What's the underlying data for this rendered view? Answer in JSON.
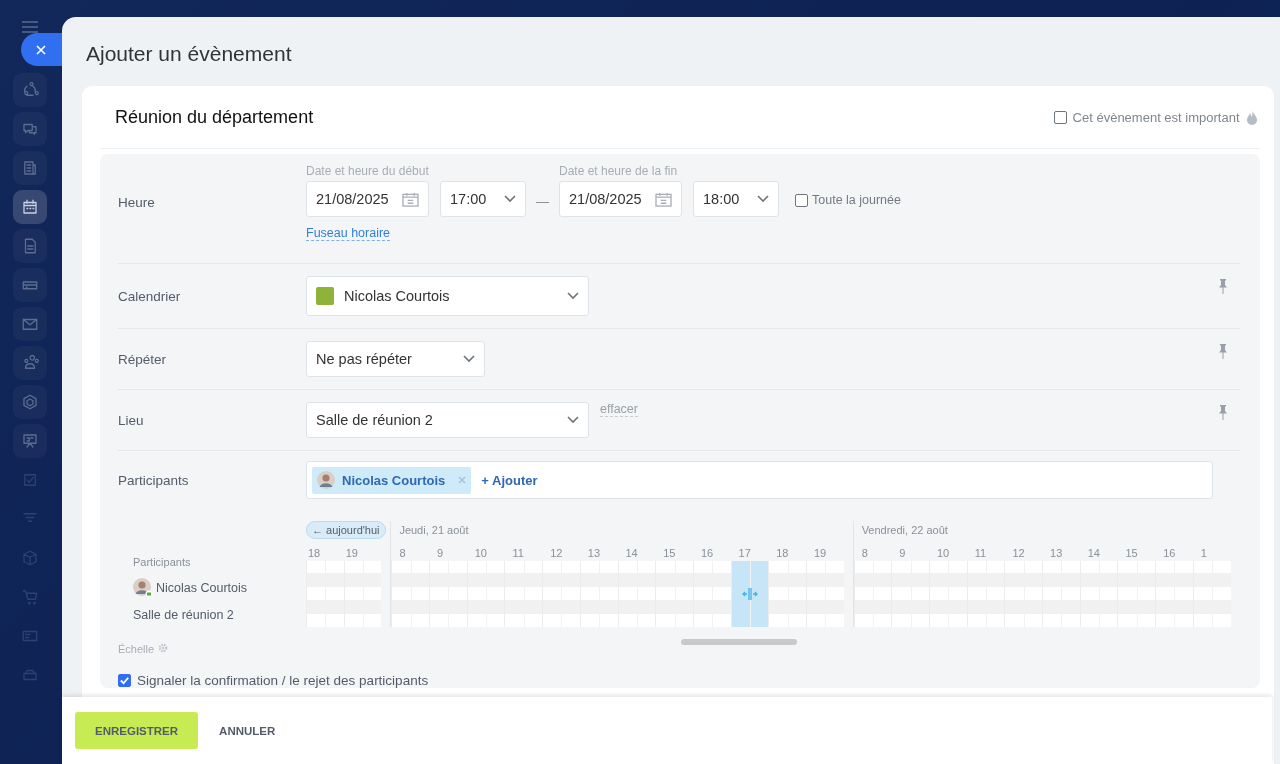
{
  "window": {
    "title": "Ajouter un évènement"
  },
  "sidebar": {
    "items": [
      {
        "selected": false
      },
      {
        "selected": false
      },
      {
        "selected": false
      },
      {
        "selected": true
      },
      {
        "selected": false
      },
      {
        "selected": false
      },
      {
        "selected": false
      },
      {
        "selected": false
      },
      {
        "selected": false
      },
      {
        "selected": false
      },
      {
        "selected": false
      },
      {
        "selected": false
      },
      {
        "selected": false
      },
      {
        "selected": false
      },
      {
        "selected": false
      },
      {
        "selected": false
      }
    ]
  },
  "event": {
    "name": "Réunion du département",
    "important": {
      "label": "Cet évènement est important",
      "checked": false
    }
  },
  "time": {
    "label": "Heure",
    "start_label": "Date et heure du début",
    "start_date": "21/08/2025",
    "start_time": "17:00",
    "separator": "—",
    "end_label": "Date et heure de la fin",
    "end_date": "21/08/2025",
    "end_time": "18:00",
    "all_day": {
      "label": "Toute la journée",
      "checked": false
    },
    "timezone_link": "Fuseau horaire"
  },
  "calendar": {
    "label": "Calendrier",
    "value": "Nicolas Courtois",
    "color": "#8fb339"
  },
  "repeat": {
    "label": "Répéter",
    "value": "Ne pas répéter"
  },
  "location": {
    "label": "Lieu",
    "value": "Salle de réunion 2",
    "clear_link": "effacer"
  },
  "participants": {
    "label": "Participants",
    "chips": [
      {
        "name": "Nicolas Courtois"
      }
    ],
    "add_link": "+ Ajouter"
  },
  "planner": {
    "today_button": "← aujourd'hui",
    "list_title": "Participants",
    "rows": [
      {
        "name": "Nicolas Courtois",
        "kind": "person"
      },
      {
        "name": "Salle de réunion 2",
        "kind": "room"
      }
    ],
    "days": [
      {
        "hours": [
          {
            "label": "18",
            "selected": false
          },
          {
            "label": "19",
            "selected": false
          }
        ]
      },
      {
        "title": "Jeudi, 21 août",
        "hours": [
          {
            "label": "8",
            "selected": false
          },
          {
            "label": "9",
            "selected": false
          },
          {
            "label": "10",
            "selected": false
          },
          {
            "label": "11",
            "selected": false
          },
          {
            "label": "12",
            "selected": false
          },
          {
            "label": "13",
            "selected": false
          },
          {
            "label": "14",
            "selected": false
          },
          {
            "label": "15",
            "selected": false
          },
          {
            "label": "16",
            "selected": false
          },
          {
            "label": "17",
            "selected": true
          },
          {
            "label": "18",
            "selected": false
          },
          {
            "label": "19",
            "selected": false
          }
        ]
      },
      {
        "title": "Vendredi, 22 août",
        "hours": [
          {
            "label": "8",
            "selected": false
          },
          {
            "label": "9",
            "selected": false
          },
          {
            "label": "10",
            "selected": false
          },
          {
            "label": "11",
            "selected": false
          },
          {
            "label": "12",
            "selected": false
          },
          {
            "label": "13",
            "selected": false
          },
          {
            "label": "14",
            "selected": false
          },
          {
            "label": "15",
            "selected": false
          },
          {
            "label": "16",
            "selected": false
          },
          {
            "label": "1",
            "selected": false
          }
        ]
      }
    ],
    "scale_label": "Échelle"
  },
  "notify": {
    "label": "Signaler la confirmation / le rejet des participants",
    "checked": true
  },
  "footer": {
    "buttons": [
      {
        "label": "ENREGISTRER",
        "kind": "primary"
      },
      {
        "label": "ANNULER",
        "kind": "secondary"
      }
    ]
  }
}
